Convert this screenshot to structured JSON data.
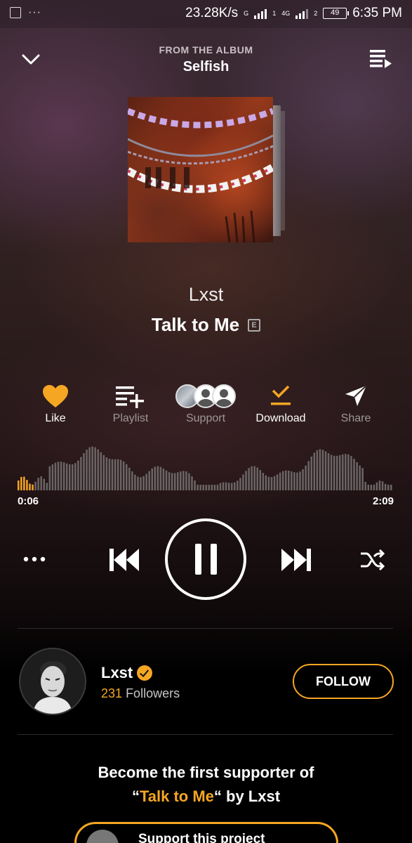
{
  "status_bar": {
    "dots": "···",
    "speed": "23.28K/s",
    "net1": "G",
    "net2": "4G",
    "sim1": "1",
    "sim2": "2",
    "battery": "49",
    "time": "6:35 PM"
  },
  "header": {
    "from_label": "FROM THE ALBUM",
    "album": "Selfish"
  },
  "track": {
    "artist": "Lxst",
    "title": "Talk to Me",
    "explicit": "E"
  },
  "actions": [
    {
      "label": "Like",
      "icon": "heart-icon"
    },
    {
      "label": "Playlist",
      "icon": "playlist-add-icon"
    },
    {
      "label": "Support",
      "icon": "supporters-avatars"
    },
    {
      "label": "Download",
      "icon": "download-icon"
    },
    {
      "label": "Share",
      "icon": "share-icon"
    }
  ],
  "progress": {
    "current": "0:06",
    "total": "2:09",
    "fraction": 0.047
  },
  "artist_card": {
    "name": "Lxst",
    "followers_count": "231",
    "followers_label": "Followers",
    "follow_button": "FOLLOW"
  },
  "support": {
    "line1": "Become the first supporter of",
    "quote_open": "“",
    "track": "Talk to Me",
    "quote_close": "“ by Lxst",
    "button": "Support this project"
  },
  "colors": {
    "accent": "#f5a623",
    "background": "#000000"
  }
}
